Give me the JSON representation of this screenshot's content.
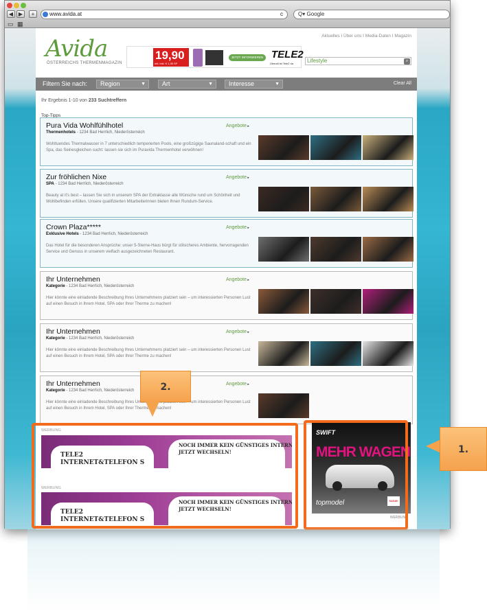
{
  "browser": {
    "url": "www.avida.at",
    "search_placeholder": "Google",
    "nav_back": "◀",
    "nav_fwd": "▶",
    "add": "+",
    "reload": "c"
  },
  "site": {
    "logo": "Avida",
    "tagline": "ÖSTERREICHS THERMENMAGAZIN",
    "topnav": "Aktuelles  I  Über uns  I  Media-Daten  I  Magazin",
    "search_value": "Lifestyle",
    "banner": {
      "price": "19,90",
      "price_note": "mtl. inkl. € 1,35 SP",
      "button": "JETZT INFORMIEREN",
      "brand": "TELE2",
      "brand_sub": "Überall ist Tele2 da"
    }
  },
  "filter": {
    "label": "Filtern Sie nach:",
    "dropdowns": [
      "Region",
      "Art",
      "Interesse"
    ],
    "clear": "Clear All"
  },
  "results_prefix": "Ihr Ergebnis 1-10 von ",
  "results_count": "233 Suchtreffern",
  "section_title": "Top-Tipps",
  "cards": [
    {
      "title": "Pura Vida  Wohlfühlhotel",
      "category": "Thermenhotels",
      "location": " - 1234 Bad Herrlich, Niederösterreich",
      "offer": "Angebote",
      "desc": "Wohltuendes Thermalwasser in 7 unterschiedlich temperierten Pools, eine großzügige Saunaland-schaft und ein Spa, das Seinesgleichen sucht: lassen sie sich im Puravida Thermenhotel verwöhnen!"
    },
    {
      "title": "Zur fröhlichen Nixe",
      "category": "SPA",
      "location": " - 1234 Bad Herrlich, Niederösterreich",
      "offer": "Angebote",
      "desc": "Beauty at it's best – lassen Sie sich in unserem SPA der Extraklasse alle Wünsche rund um Schönheit und Wohlbefinden erfüllen. Unsere qualifizierten Mitarbeiterinnen bieten Ihnen Rundum-Service."
    },
    {
      "title": "Crown Plaza*****",
      "category": "Exklusive Hotels",
      "location": " - 1234 Bad Herrlich, Niederösterreich",
      "offer": "Angebote",
      "desc": "Das Hotel für die besonderen Ansprüche: unser 5-Sterne-Haus bürgt für stilsicheres Ambiente, hervorragenden Service und Genuss in unserem vielfach ausgezeichneten Restaurant."
    },
    {
      "title": "Ihr Unternehmen",
      "category": "Kategorie",
      "location": " - 1234 Bad Herrlich, Niederösterreich",
      "offer": "Angebote",
      "desc": "Hier könnte eine einladende Beschreibung Ihres Unternehmens platziert sein – um interessierten Personen Lust auf einen Besuch in Ihrem Hotel, SPA oder Ihrer Therme zu machen!"
    },
    {
      "title": "Ihr Unternehmen",
      "category": "Kategorie",
      "location": " - 1234 Bad Herrlich, Niederösterreich",
      "offer": "Angebote",
      "desc": "Hier könnte eine einladende Beschreibung Ihres Unternehmens platziert sein – um interessierten Personen Lust auf einen Besuch in Ihrem Hotel, SPA oder Ihrer Therme zu machen!"
    },
    {
      "title": "Ihr Unternehmen",
      "category": "Kategorie",
      "location": " - 1234 Bad Herrlich, Niederösterreich",
      "offer": "Angebote",
      "desc": "Hier könnte eine einladende Beschreibung Ihres Unternehmens platziert sein – um interessierten Personen Lust auf einen Besuch in Ihrem Hotel, SPA oder Ihrer Therme zu machen!"
    }
  ],
  "ads": {
    "label": "WERBUNG",
    "strip_left": "TELE2\nINTERNET&TELEFON S",
    "strip_right": "NOCH IMMER KEIN GÜNSTIGES INTERNET?\nJETZT WECHSELN!",
    "side_brand": "SWIFT",
    "side_headline": "MEHR WAGEN",
    "side_sub": "topmodel",
    "side_maker": "SUZUKI"
  },
  "callouts": {
    "one": "1.",
    "two": "2."
  },
  "colors": {
    "accent_green": "#5d9b3d",
    "highlight_orange": "#f26a1b",
    "tele2_purple": "#8a3585",
    "suzuki_pink": "#e0137f"
  }
}
